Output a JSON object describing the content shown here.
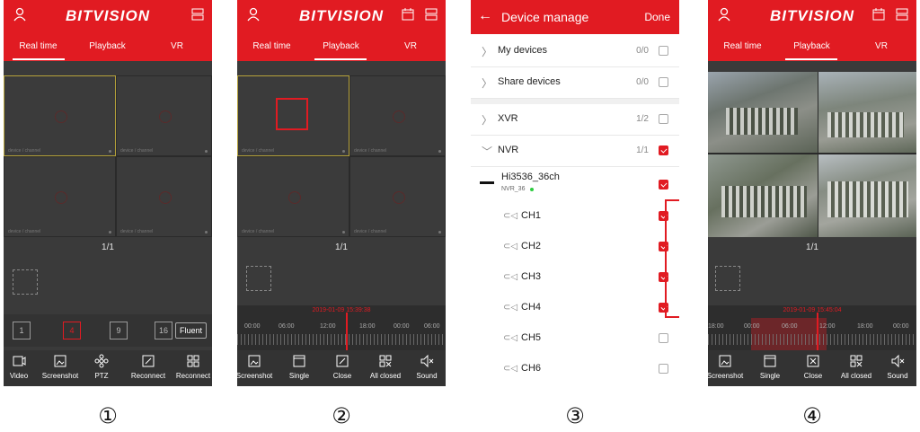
{
  "brand": "BITVISION",
  "colors": {
    "accent": "#e11b22",
    "dark_bg": "#3a3a3a"
  },
  "cell_label": "device / channel",
  "screen1": {
    "tabs": [
      "Real time",
      "Playback",
      "VR"
    ],
    "page": "1/1",
    "layouts": [
      "1",
      "4",
      "9",
      "16"
    ],
    "quality": "Fluent",
    "toolbar": [
      "Video",
      "Screenshot",
      "PTZ",
      "Reconnect",
      "Reconnect"
    ]
  },
  "screen2": {
    "tabs": [
      "Real time",
      "Playback",
      "VR"
    ],
    "page": "1/1",
    "timestamp": "2019-01-09 15:39:38",
    "ticks": [
      "00:00",
      "06:00",
      "12:00",
      "18:00",
      "00:00",
      "06:00"
    ],
    "toolbar": [
      "Screenshot",
      "Single",
      "Close",
      "All closed",
      "Sound"
    ]
  },
  "screen3": {
    "title": "Device manage",
    "done": "Done",
    "groups": [
      {
        "name": "My devices",
        "count": "0/0",
        "checked": false
      },
      {
        "name": "Share devices",
        "count": "0/0",
        "checked": false
      }
    ],
    "types": [
      {
        "name": "XVR",
        "count": "1/2",
        "checked": false
      },
      {
        "name": "NVR",
        "count": "1/1",
        "checked": true
      }
    ],
    "device": {
      "name": "Hi3536_36ch",
      "sub": "NVR_36"
    },
    "channels": [
      {
        "name": "CH1",
        "checked": true
      },
      {
        "name": "CH2",
        "checked": true
      },
      {
        "name": "CH3",
        "checked": true
      },
      {
        "name": "CH4",
        "checked": true
      },
      {
        "name": "CH5",
        "checked": false
      },
      {
        "name": "CH6",
        "checked": false
      }
    ]
  },
  "screen4": {
    "tabs": [
      "Real time",
      "Playback",
      "VR"
    ],
    "page": "1/1",
    "timestamp": "2019-01-09 15:45:04",
    "ticks": [
      "18:00",
      "00:00",
      "06:00",
      "12:00",
      "18:00",
      "00:00"
    ],
    "toolbar": [
      "Screenshot",
      "Single",
      "Close",
      "All closed",
      "Sound"
    ]
  },
  "step_labels": [
    "①",
    "②",
    "③",
    "④"
  ]
}
